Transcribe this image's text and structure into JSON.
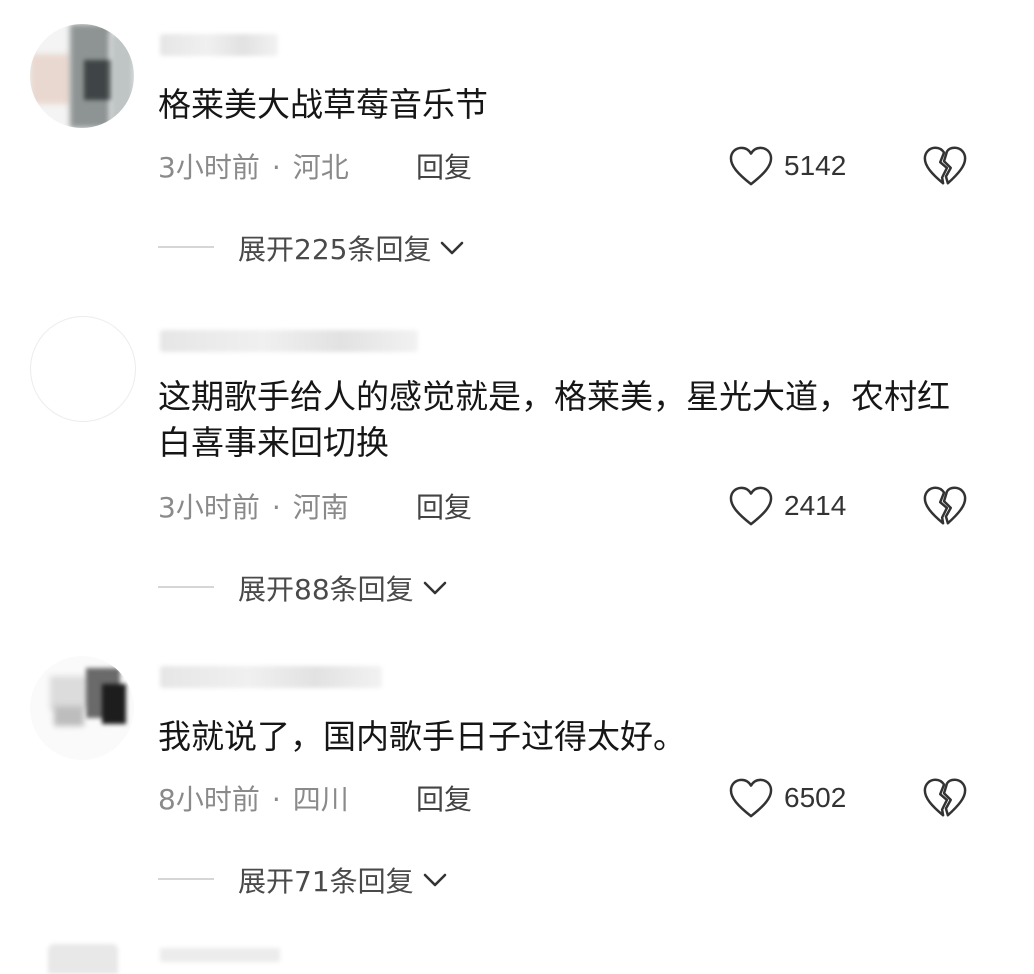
{
  "comments": [
    {
      "text": "格莱美大战草莓音乐节",
      "time": "3小时前",
      "sep": "·",
      "location": "河北",
      "reply_label": "回复",
      "likes": "5142",
      "expand_label": "展开225条回复"
    },
    {
      "text": "这期歌手给人的感觉就是，格莱美，星光大道，农村红白喜事来回切换",
      "time": "3小时前",
      "sep": "·",
      "location": "河南",
      "reply_label": "回复",
      "likes": "2414",
      "expand_label": "展开88条回复"
    },
    {
      "text": "我就说了，国内歌手日子过得太好。",
      "time": "8小时前",
      "sep": "·",
      "location": "四川",
      "reply_label": "回复",
      "likes": "6502",
      "expand_label": "展开71条回复"
    }
  ],
  "icons": {
    "like": "heart-outline-icon",
    "dislike": "broken-heart-icon",
    "expand": "chevron-down-icon"
  },
  "colors": {
    "meta_text": "#8a8a8a",
    "body_text": "#161616",
    "icon_stroke": "#333333"
  }
}
